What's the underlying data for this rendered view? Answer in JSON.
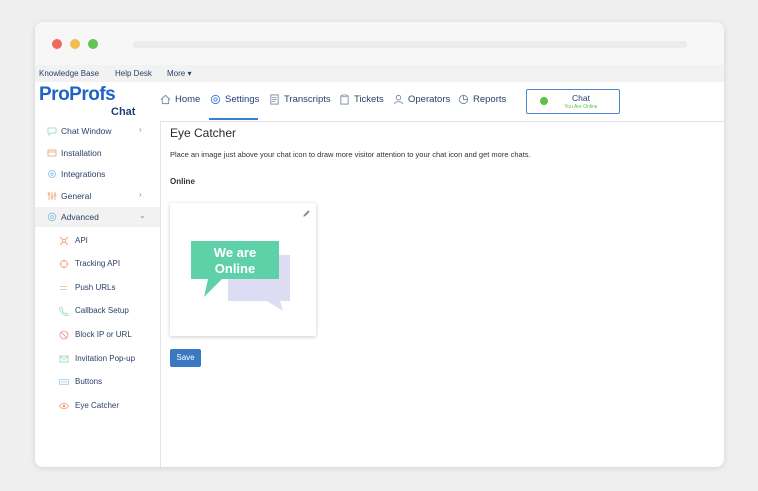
{
  "top_menu": {
    "knowledge_base": "Knowledge Base",
    "help_desk": "Help Desk",
    "more": "More ▾"
  },
  "logo": {
    "pro": "ProProfs",
    "chat": "Chat"
  },
  "nav": {
    "items": [
      {
        "label": "Home",
        "icon": "home-icon"
      },
      {
        "label": "Settings",
        "icon": "settings-icon"
      },
      {
        "label": "Transcripts",
        "icon": "transcripts-icon"
      },
      {
        "label": "Tickets",
        "icon": "tickets-icon"
      },
      {
        "label": "Operators",
        "icon": "operators-icon"
      },
      {
        "label": "Reports",
        "icon": "reports-icon"
      }
    ],
    "active": "Settings"
  },
  "status": {
    "title": "Chat",
    "subtitle": "You Are Online",
    "color": "#5cc04a"
  },
  "sidebar": {
    "items": [
      {
        "label": "Chat Window",
        "chevron": "›"
      },
      {
        "label": "Installation"
      },
      {
        "label": "Integrations"
      },
      {
        "label": "General",
        "chevron": "›"
      },
      {
        "label": "Advanced",
        "chevron": "⌄"
      }
    ],
    "sub_items": [
      {
        "label": "API"
      },
      {
        "label": "Tracking API"
      },
      {
        "label": "Push URLs"
      },
      {
        "label": "Callback Setup"
      },
      {
        "label": "Block IP or URL"
      },
      {
        "label": "Invitation Pop-up"
      },
      {
        "label": "Buttons"
      },
      {
        "label": "Eye Catcher"
      }
    ]
  },
  "main": {
    "title": "Eye Catcher",
    "description": "Place an image just above your chat icon to draw more visitor attention to your chat icon and get more chats.",
    "section_label": "Online",
    "bubble_line1": "We are",
    "bubble_line2": "Online",
    "save_label": "Save"
  },
  "colors": {
    "accent": "#3a79c2",
    "bubble": "#5fd1a9",
    "bubble_shadow": "#dcdcf3"
  }
}
